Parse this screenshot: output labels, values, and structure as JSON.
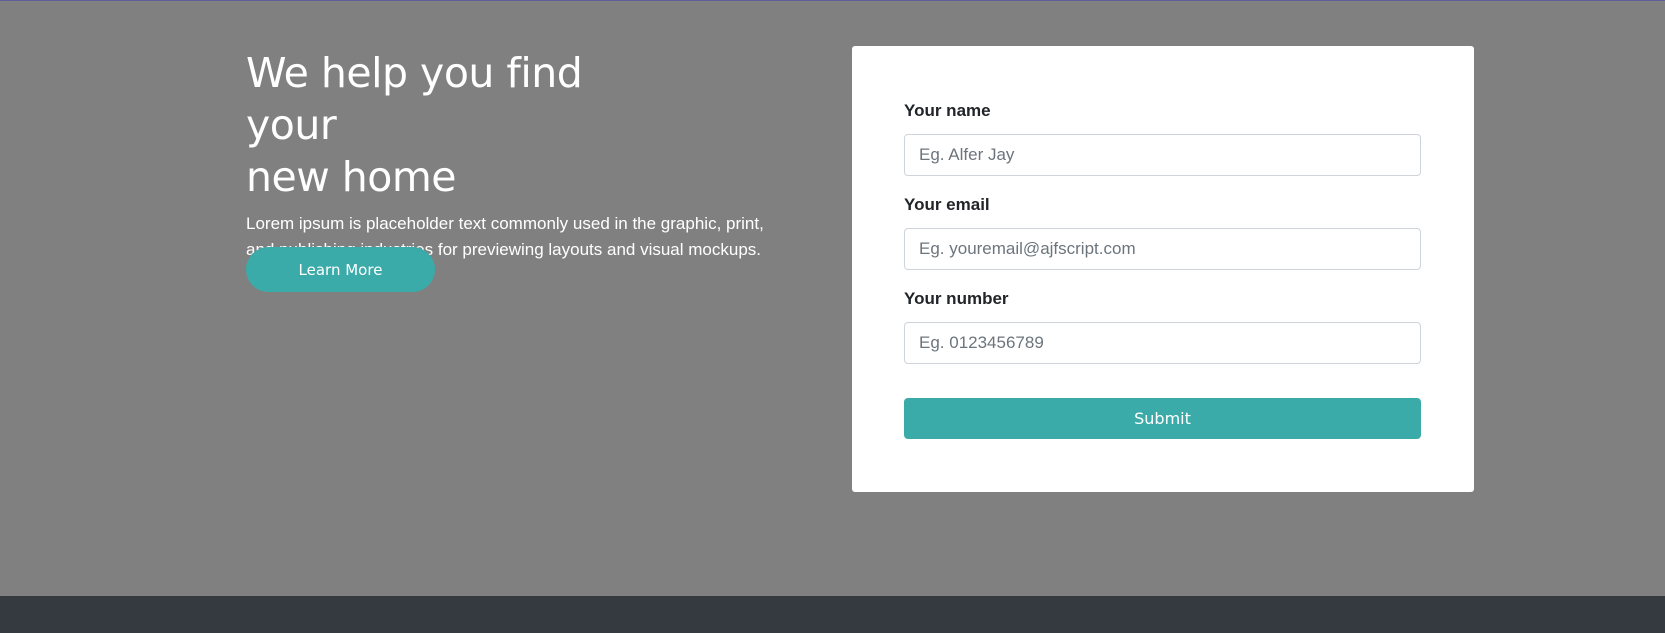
{
  "hero": {
    "title_line1": "We help you find your",
    "title_line2": "new home",
    "description": "Lorem ipsum is placeholder text commonly used in the graphic, print, and publishing industries for previewing layouts and visual mockups.",
    "cta_label": "Learn More"
  },
  "form": {
    "name_label": "Your name",
    "name_placeholder": "Eg. Alfer Jay",
    "email_label": "Your email",
    "email_placeholder": "Eg. youremail@ajfscript.com",
    "number_label": "Your number",
    "number_placeholder": "Eg. 0123456789",
    "submit_label": "Submit"
  },
  "colors": {
    "accent": "#3aaba9",
    "hero_bg": "#808080",
    "footer_bg": "#343a40",
    "card_bg": "#ffffff"
  }
}
